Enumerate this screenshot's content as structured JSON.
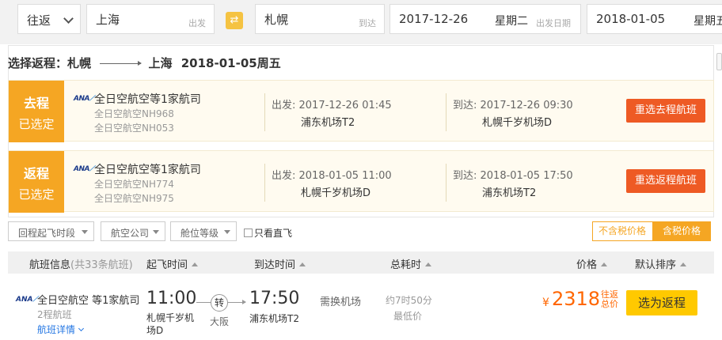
{
  "search": {
    "trip_type": "往返",
    "from_city": "上海",
    "from_hint": "出发",
    "swap_icon": "swap-arrows-icon",
    "to_city": "札幌",
    "to_hint": "到达",
    "depart_date": "2017-12-26",
    "depart_weekday": "星期二",
    "depart_date_hint": "出发日期",
    "return_date": "2018-01-05",
    "return_weekday": "星期五"
  },
  "route": {
    "label": "选择返程：",
    "from": "札幌",
    "to": "上海",
    "date": "2018-01-05周五"
  },
  "legs": [
    {
      "tag_top": "去程",
      "tag_bottom": "已选定",
      "airline": "全日空航空等1家航司",
      "flight1": "全日空航空NH968",
      "flight2": "全日空航空NH053",
      "depart": "出发: 2017-12-26 01:45",
      "depart_airport": "浦东机场T2",
      "arrive": "到达: 2017-12-26 09:30",
      "arrive_airport": "札幌千岁机场D",
      "action": "重选去程航班"
    },
    {
      "tag_top": "返程",
      "tag_bottom": "已选定",
      "airline": "全日空航空等1家航司",
      "flight1": "全日空航空NH774",
      "flight2": "全日空航空NH975",
      "depart": "出发: 2018-01-05 11:00",
      "depart_airport": "札幌千岁机场D",
      "arrive": "到达: 2018-01-05 17:50",
      "arrive_airport": "浦东机场T2",
      "action": "重选返程航班"
    }
  ],
  "filters": {
    "return_time": "回程起飞时段",
    "airline": "航空公司",
    "cabin": "舱位等级",
    "direct_only": "只看直飞",
    "tax_excluded": "不含税价格",
    "tax_included": "含税价格"
  },
  "list_header": {
    "flight_info": "航班信息",
    "count": "(共33条航班)",
    "depart_time": "起飞时间",
    "arrive_time": "到达时间",
    "duration": "总耗时",
    "price": "价格",
    "sort": "默认排序"
  },
  "result": {
    "logo_text": "ANA",
    "airline": "全日空航空 等1家航司",
    "segments": "2程航班",
    "detail_link": "航班详情",
    "depart_time": "11:00",
    "depart_airport": "札幌千岁机场D",
    "transfer_label": "转",
    "transfer_city": "大阪",
    "arrive_time": "17:50",
    "arrive_airport": "浦东机场T2",
    "change_airport": "需换机场",
    "duration": "约7时50分",
    "lowest": "最低价",
    "currency": "¥",
    "price": "2318",
    "price_note": "往返总价",
    "book_button": "选为返程"
  },
  "colors": {
    "accent_orange": "#f5a623",
    "action_red": "#ee5a24",
    "price_orange": "#ff6600",
    "book_yellow": "#ffc900",
    "link_blue": "#2577e3"
  }
}
